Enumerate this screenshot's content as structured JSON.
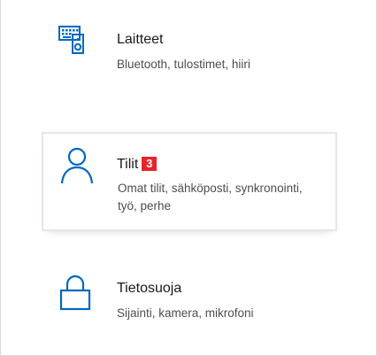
{
  "accent_color": "#0067c0",
  "badge_color": "#e8232b",
  "categories": [
    {
      "id": "devices",
      "title": "Laitteet",
      "subtitle": "Bluetooth, tulostimet, hiiri",
      "icon": "keyboard-speaker-icon"
    },
    {
      "id": "accounts",
      "title": "Tilit",
      "subtitle": "Omat tilit, sähköposti, synkronointi, työ, perhe",
      "icon": "person-icon",
      "step_badge": "3"
    },
    {
      "id": "privacy",
      "title": "Tietosuoja",
      "subtitle": "Sijainti, kamera, mikrofoni",
      "icon": "lock-icon"
    }
  ]
}
